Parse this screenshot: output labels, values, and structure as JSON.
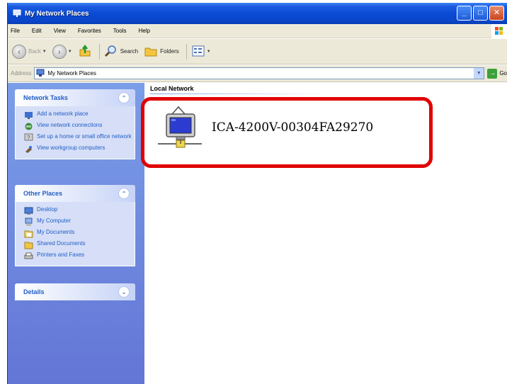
{
  "window": {
    "title": "My Network Places"
  },
  "menu": [
    "File",
    "Edit",
    "View",
    "Favorites",
    "Tools",
    "Help"
  ],
  "toolbar": {
    "back": "Back",
    "search": "Search",
    "folders": "Folders"
  },
  "address": {
    "label": "Address",
    "value": "My Network Places",
    "go": "Go"
  },
  "sidebar": {
    "network_tasks": {
      "title": "Network Tasks",
      "items": [
        {
          "label": "Add a network place",
          "icon": "add-network-place-icon"
        },
        {
          "label": "View network connections",
          "icon": "network-connections-icon"
        },
        {
          "label": "Set up a home or small office network",
          "icon": "home-network-icon"
        },
        {
          "label": "View workgroup computers",
          "icon": "workgroup-icon"
        }
      ]
    },
    "other_places": {
      "title": "Other Places",
      "items": [
        {
          "label": "Desktop",
          "icon": "desktop-icon"
        },
        {
          "label": "My Computer",
          "icon": "my-computer-icon"
        },
        {
          "label": "My Documents",
          "icon": "my-documents-icon"
        },
        {
          "label": "Shared Documents",
          "icon": "shared-documents-icon"
        },
        {
          "label": "Printers and Faxes",
          "icon": "printers-icon"
        }
      ]
    },
    "details": {
      "title": "Details"
    }
  },
  "content": {
    "group_title": "Local Network",
    "device_name": "ICA-4200V-00304FA29270",
    "device_icon": "network-camera-icon"
  },
  "colors": {
    "titlebar": "#0a4ad4",
    "sidebar": "#6375d6",
    "highlight": "#e00000",
    "link": "#215dc6"
  }
}
